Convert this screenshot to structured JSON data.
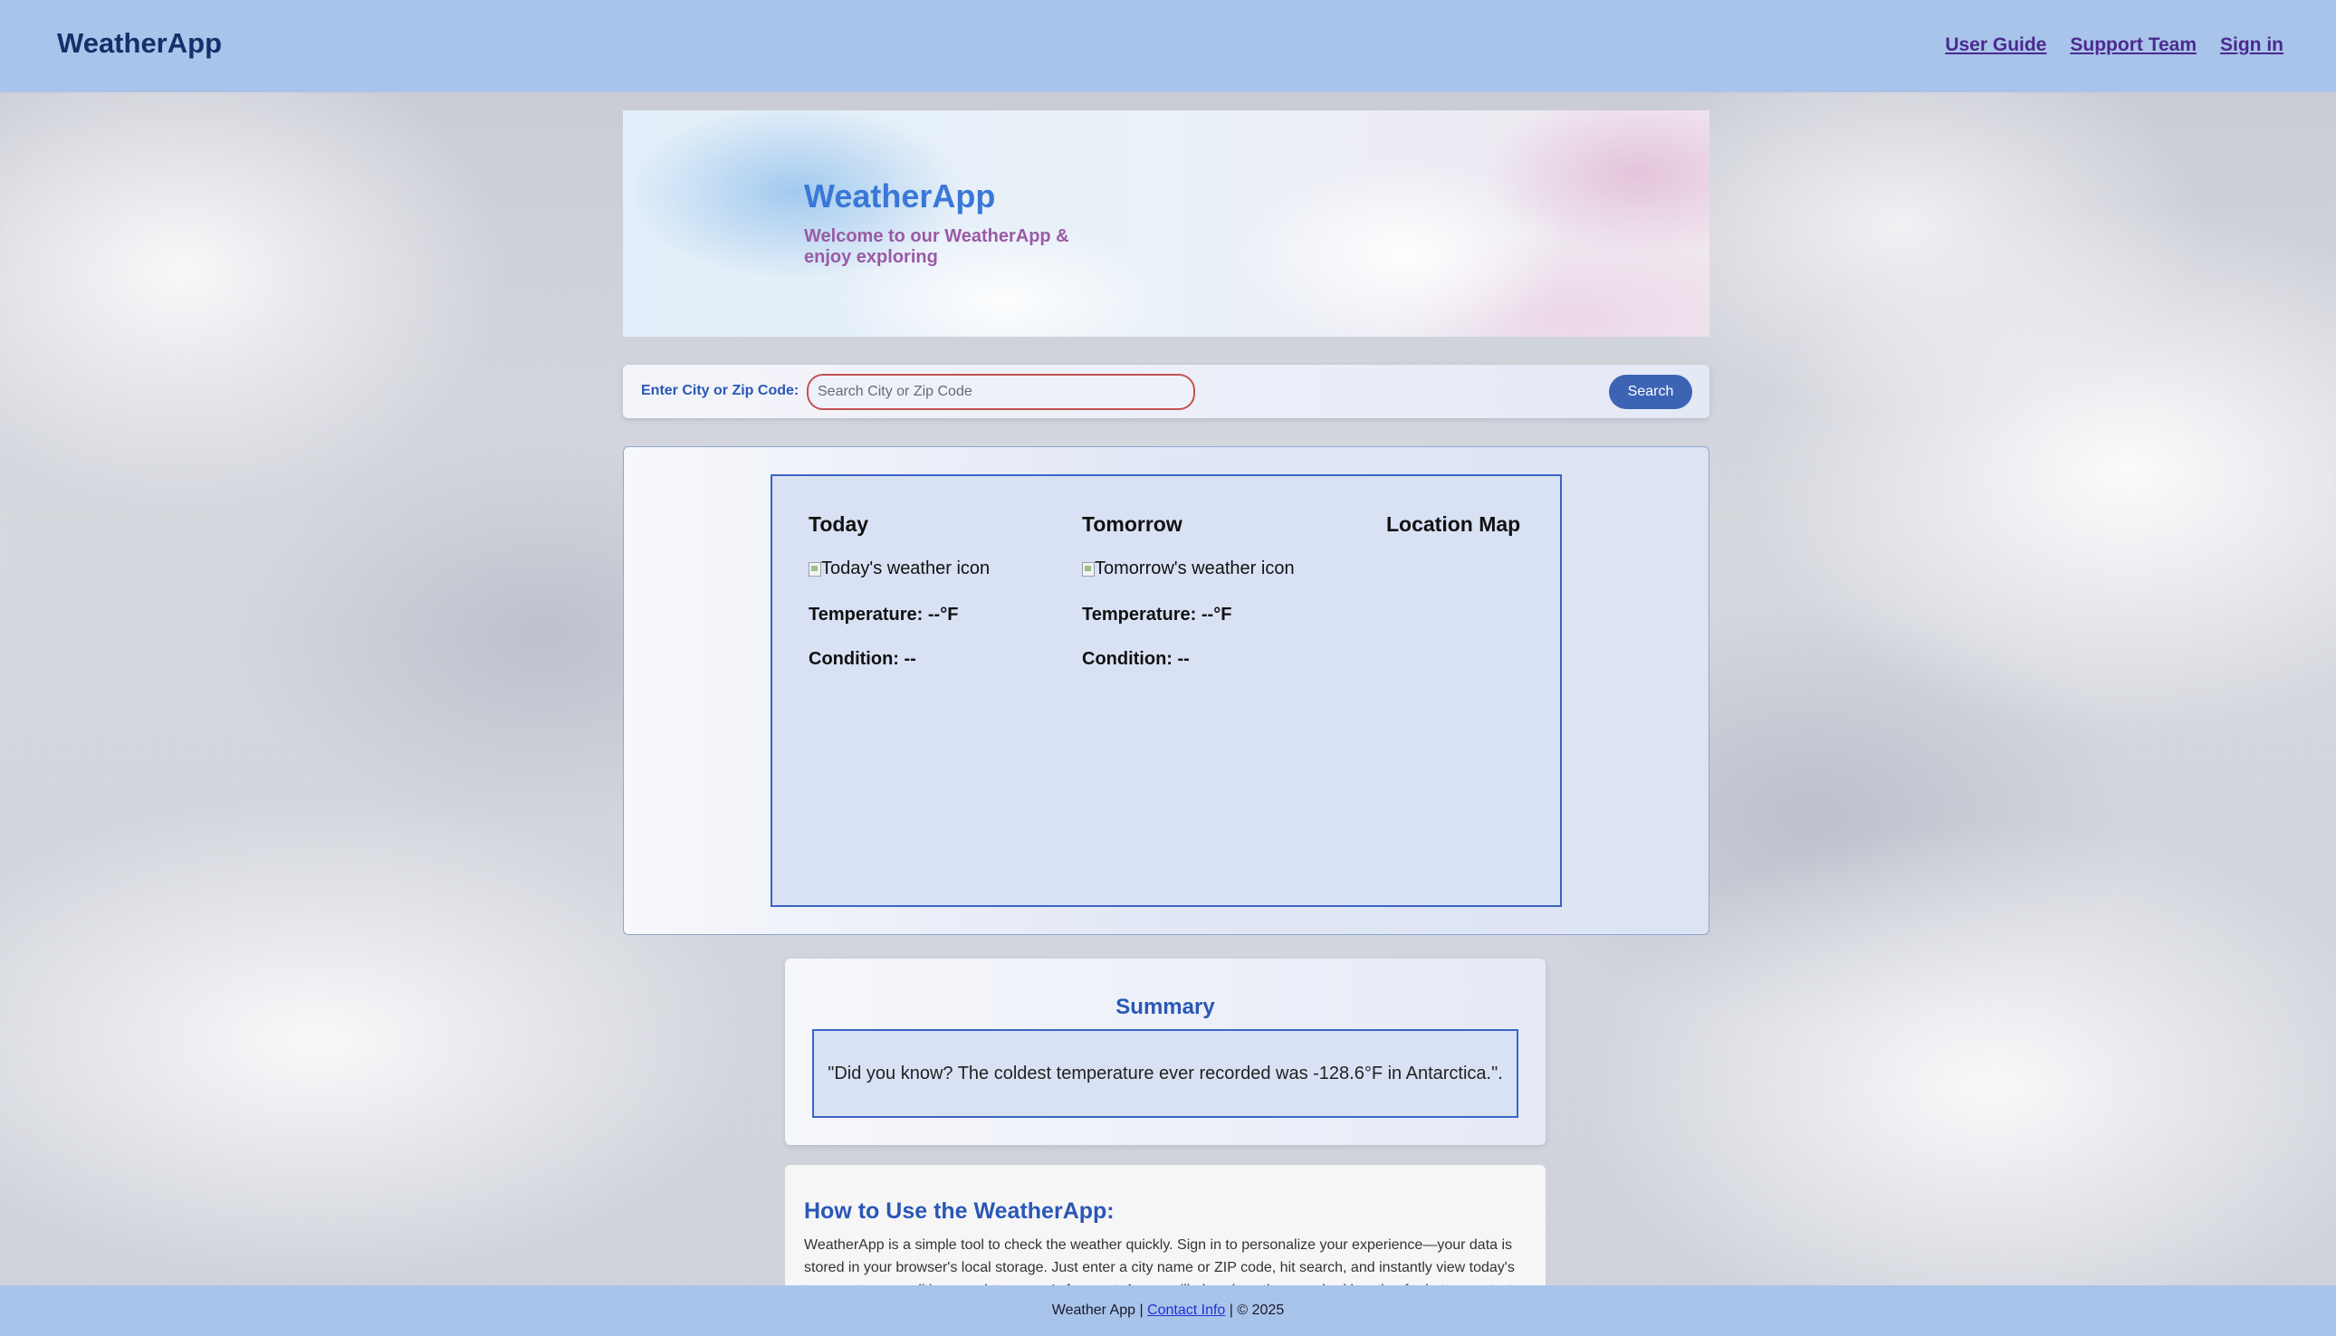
{
  "header": {
    "brand": "WeatherApp",
    "nav": {
      "user_guide": "User Guide",
      "support_team": "Support Team",
      "sign_in": "Sign in"
    }
  },
  "hero": {
    "title": "WeatherApp",
    "subtitle": "Welcome to our WeatherApp & enjoy exploring"
  },
  "search": {
    "label": "Enter City or Zip Code:",
    "placeholder": "Search City or Zip Code",
    "value": "",
    "button_label": "Search"
  },
  "forecast": {
    "today": {
      "heading": "Today",
      "icon_alt": "Today's weather icon",
      "temperature": "Temperature: --°F",
      "condition": "Condition: --"
    },
    "tomorrow": {
      "heading": "Tomorrow",
      "icon_alt": "Tomorrow's weather icon",
      "temperature": "Temperature: --°F",
      "condition": "Condition: --"
    },
    "map": {
      "heading": "Location Map"
    }
  },
  "summary": {
    "title": "Summary",
    "text": "\"Did you know? The coldest temperature ever recorded was -128.6°F in Antarctica.\"."
  },
  "howto": {
    "title": "How to Use the WeatherApp:",
    "body": "WeatherApp is a simple tool to check the weather quickly. Sign in to personalize your experience—your data is stored in your browser's local storage. Just enter a city name or ZIP code, hit search, and instantly view today's temperature, conditions, and tomorrow's forecast. A map will also show the searched location for better context."
  },
  "footer": {
    "prefix": "Weather App |",
    "contact_link": "Contact Info",
    "suffix": "| © 2025"
  },
  "colors": {
    "nav_bg": "#a9c4ea",
    "brand": "#14306b",
    "accent_blue": "#2a57b5",
    "hero_title": "#3a78d8",
    "hero_subtitle": "#9a5aa6",
    "search_button": "#3c63b4",
    "input_border": "#c55151",
    "nav_link": "#4b2a8f"
  }
}
